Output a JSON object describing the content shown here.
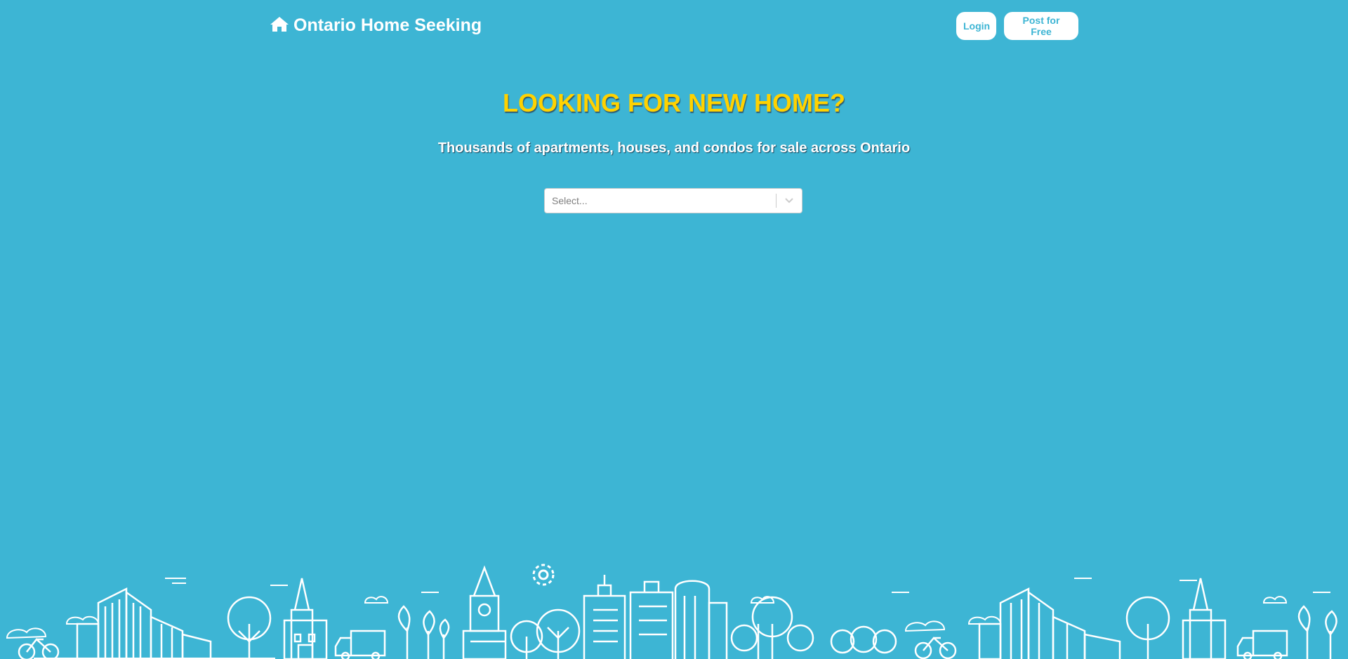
{
  "header": {
    "brand": "Ontario Home Seeking",
    "brand_icon": "home-icon",
    "login_label": "Login",
    "post_label": "Post for Free"
  },
  "hero": {
    "title": "LOOKING FOR NEW HOME?",
    "subtitle": "Thousands of apartments, houses, and condos for sale across Ontario"
  },
  "search": {
    "placeholder": "Select...",
    "chevron_icon": "chevron-down-icon"
  },
  "colors": {
    "background": "#3db5d4",
    "title": "#ffd200",
    "button_text": "#3db5d4"
  }
}
